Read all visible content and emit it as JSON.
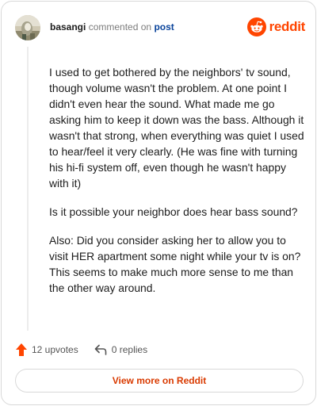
{
  "header": {
    "username": "basangi",
    "commented_on": "commented on",
    "post_link": "post",
    "brand_name": "reddit"
  },
  "comment": {
    "paragraphs": [
      "I used to get bothered by the neighbors' tv sound, though volume wasn't the problem. At one point I didn't even hear the sound. What made me go asking him to keep it down was the bass. Although it wasn't that strong, when everything was quiet I used to hear/feel it very clearly. (He was fine with turning his hi-fi system off, even though he wasn't happy with it)",
      "Is it possible your neighbor does hear bass sound?",
      "Also: Did you consider asking her to allow you to visit HER apartment some night while your tv is on? This seems to make much more sense to me than the other way around."
    ]
  },
  "actions": {
    "upvotes": "12 upvotes",
    "replies": "0 replies"
  },
  "footer": {
    "view_more": "View more on Reddit"
  },
  "colors": {
    "brand": "#ff4500",
    "upvote": "#ff4500",
    "link": "#0a449b",
    "view_more_text": "#d93a00"
  },
  "icons": {
    "brand": "reddit-alien-icon",
    "upvote": "upvote-arrow-icon",
    "reply": "reply-arrow-icon"
  }
}
